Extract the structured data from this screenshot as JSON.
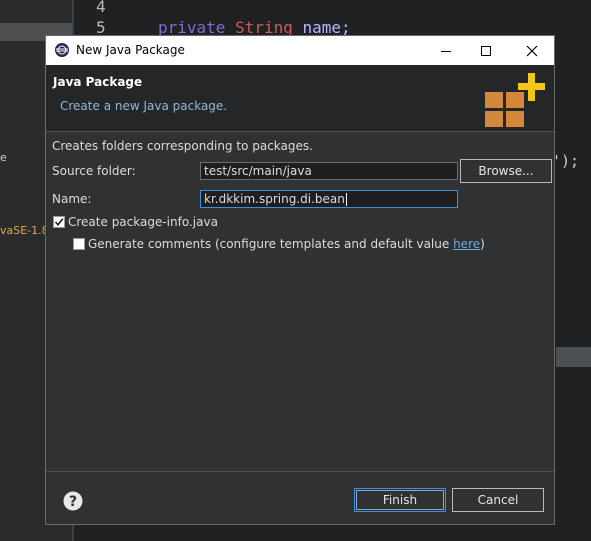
{
  "background_editor": {
    "line_numbers": [
      "4",
      "5"
    ],
    "code_line": {
      "keyword": "private",
      "type": "String",
      "identifier": "name;"
    },
    "fragment_e": "e",
    "fragment_jre": "vaSE-1.8",
    "fragment_paren": "');"
  },
  "dialog": {
    "title": "New Java Package",
    "minimize_glyph": "—",
    "maximize_glyph": "☐",
    "close_glyph": "✕",
    "header": {
      "title": "Java Package",
      "description": "Create a new Java package."
    },
    "body_description": "Creates folders corresponding to packages.",
    "source_folder": {
      "label": "Source folder:",
      "value": "test/src/main/java",
      "browse_label": "Browse..."
    },
    "name": {
      "label": "Name:",
      "value": "kr.dkkim.spring.di.bean"
    },
    "create_package_info": {
      "label": "Create package-info.java",
      "checked": true
    },
    "generate_comments": {
      "label": "Generate comments (configure templates and default value ",
      "link": "here",
      "suffix": ")",
      "checked": false
    },
    "footer": {
      "help_icon": "question-circle-icon",
      "finish_label": "Finish",
      "cancel_label": "Cancel"
    }
  },
  "colors": {
    "accent_blue": "#3f8ee0",
    "package_icon_orange": "#d4883a",
    "plus_yellow": "#f5c518",
    "keyword_purple": "#7e6bd6",
    "type_red": "#cc5a5a"
  }
}
